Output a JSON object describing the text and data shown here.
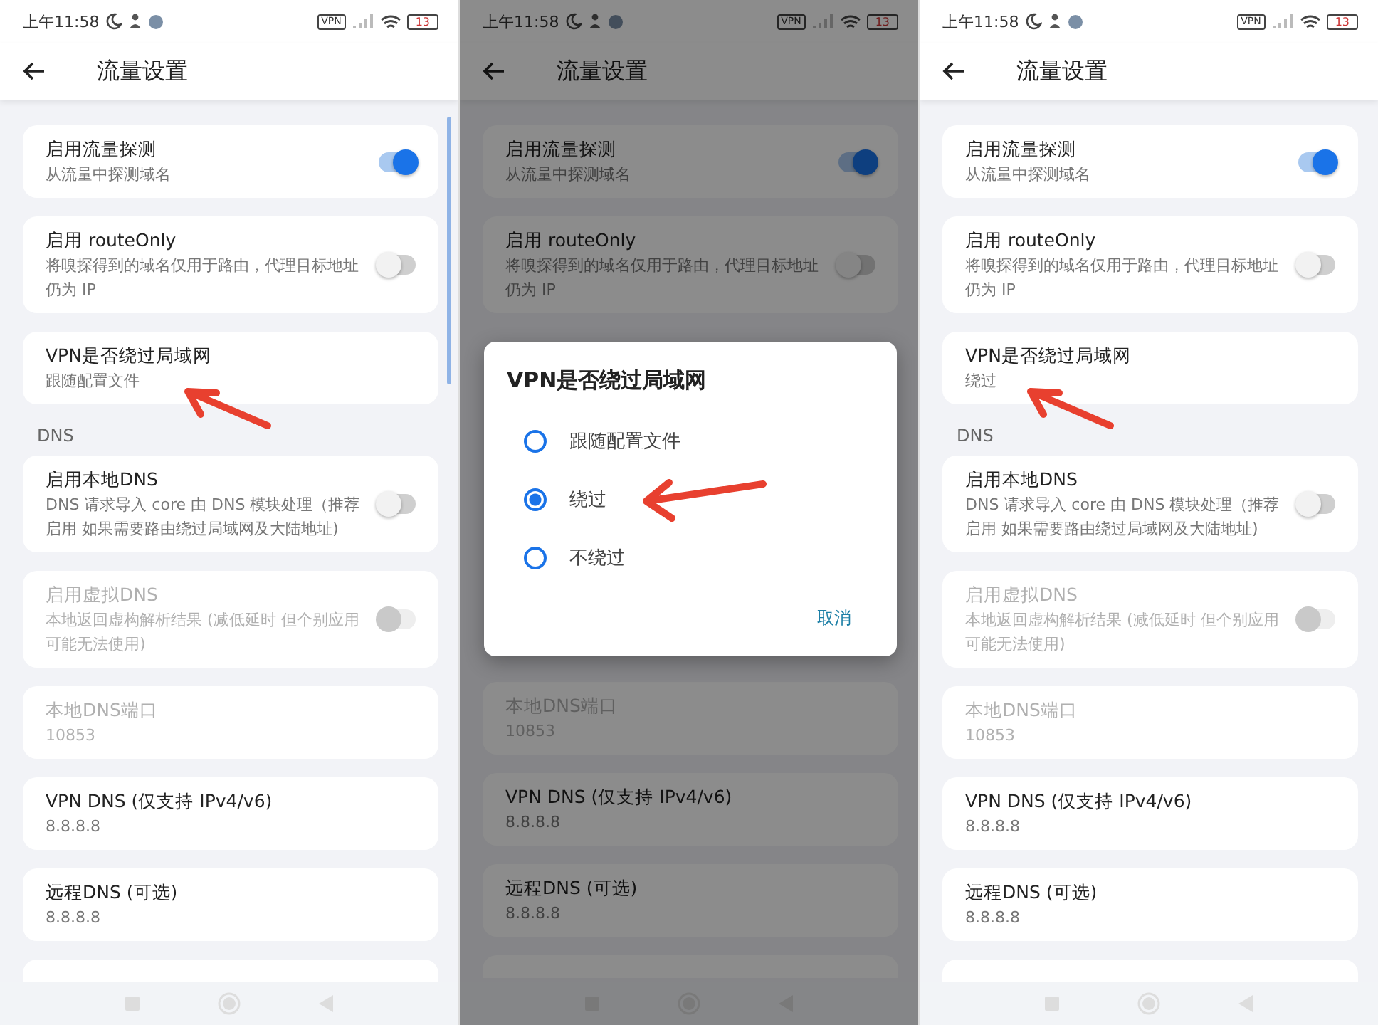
{
  "panels": [
    {
      "status_bar": {
        "time": "上午11:58",
        "vpn": "VPN",
        "battery": "13"
      },
      "title": "流量设置",
      "scrollbar_visible": true,
      "items": [
        {
          "kind": "toggle",
          "title": "启用流量探测",
          "subtitle": "从流量中探测域名",
          "on": true,
          "disabled": false
        },
        {
          "kind": "toggle",
          "title": "启用 routeOnly",
          "subtitle": "将嗅探得到的域名仅用于路由，代理目标地址仍为 IP",
          "on": false,
          "disabled": false
        },
        {
          "kind": "choice",
          "title": "VPN是否绕过局域网",
          "value": "跟随配置文件",
          "annotated": true
        },
        {
          "kind": "header",
          "title": "DNS"
        },
        {
          "kind": "toggle",
          "title": "启用本地DNS",
          "subtitle": "DNS 请求导入 core 由 DNS 模块处理（推荐启用 如果需要路由绕过局域网及大陆地址)",
          "on": false,
          "disabled": false
        },
        {
          "kind": "toggle",
          "title": "启用虚拟DNS",
          "subtitle": "本地返回虚构解析结果 (减低延时 但个别应用可能无法使用)",
          "on": false,
          "disabled": true
        },
        {
          "kind": "field",
          "title": "本地DNS端口",
          "value": "10853",
          "disabled": true
        },
        {
          "kind": "field",
          "title": "VPN DNS (仅支持 IPv4/v6)",
          "value": "8.8.8.8",
          "disabled": false
        },
        {
          "kind": "field",
          "title": "远程DNS (可选)",
          "value": "8.8.8.8",
          "disabled": false
        },
        {
          "kind": "partial"
        }
      ]
    },
    {
      "status_bar": {
        "time": "上午11:58",
        "vpn": "VPN",
        "battery": "13"
      },
      "title": "流量设置",
      "items": [
        {
          "kind": "toggle",
          "title": "启用流量探测",
          "subtitle": "从流量中探测域名",
          "on": true,
          "disabled": false
        },
        {
          "kind": "toggle",
          "title": "启用 routeOnly",
          "subtitle": "将嗅探得到的域名仅用于路由，代理目标地址仍为 IP",
          "on": false,
          "disabled": false
        },
        {
          "kind": "field",
          "title": "本地DNS端口",
          "value": "10853",
          "disabled": true
        },
        {
          "kind": "field",
          "title": "VPN DNS (仅支持 IPv4/v6)",
          "value": "8.8.8.8",
          "disabled": false
        },
        {
          "kind": "field",
          "title": "远程DNS (可选)",
          "value": "8.8.8.8",
          "disabled": false
        },
        {
          "kind": "partial"
        }
      ],
      "dialog": {
        "title": "VPN是否绕过局域网",
        "options": [
          {
            "label": "跟随配置文件",
            "selected": false
          },
          {
            "label": "绕过",
            "selected": true,
            "annotated": true
          },
          {
            "label": "不绕过",
            "selected": false
          }
        ],
        "cancel": "取消"
      }
    },
    {
      "status_bar": {
        "time": "上午11:58",
        "vpn": "VPN",
        "battery": "13"
      },
      "title": "流量设置",
      "items": [
        {
          "kind": "toggle",
          "title": "启用流量探测",
          "subtitle": "从流量中探测域名",
          "on": true,
          "disabled": false
        },
        {
          "kind": "toggle",
          "title": "启用 routeOnly",
          "subtitle": "将嗅探得到的域名仅用于路由，代理目标地址仍为 IP",
          "on": false,
          "disabled": false
        },
        {
          "kind": "choice",
          "title": "VPN是否绕过局域网",
          "value": "绕过",
          "annotated": true
        },
        {
          "kind": "header",
          "title": "DNS"
        },
        {
          "kind": "toggle",
          "title": "启用本地DNS",
          "subtitle": "DNS 请求导入 core 由 DNS 模块处理（推荐启用 如果需要路由绕过局域网及大陆地址)",
          "on": false,
          "disabled": false
        },
        {
          "kind": "toggle",
          "title": "启用虚拟DNS",
          "subtitle": "本地返回虚构解析结果 (减低延时 但个别应用可能无法使用)",
          "on": false,
          "disabled": true
        },
        {
          "kind": "field",
          "title": "本地DNS端口",
          "value": "10853",
          "disabled": true
        },
        {
          "kind": "field",
          "title": "VPN DNS (仅支持 IPv4/v6)",
          "value": "8.8.8.8",
          "disabled": false
        },
        {
          "kind": "field",
          "title": "远程DNS (可选)",
          "value": "8.8.8.8",
          "disabled": false
        },
        {
          "kind": "partial"
        }
      ]
    }
  ]
}
